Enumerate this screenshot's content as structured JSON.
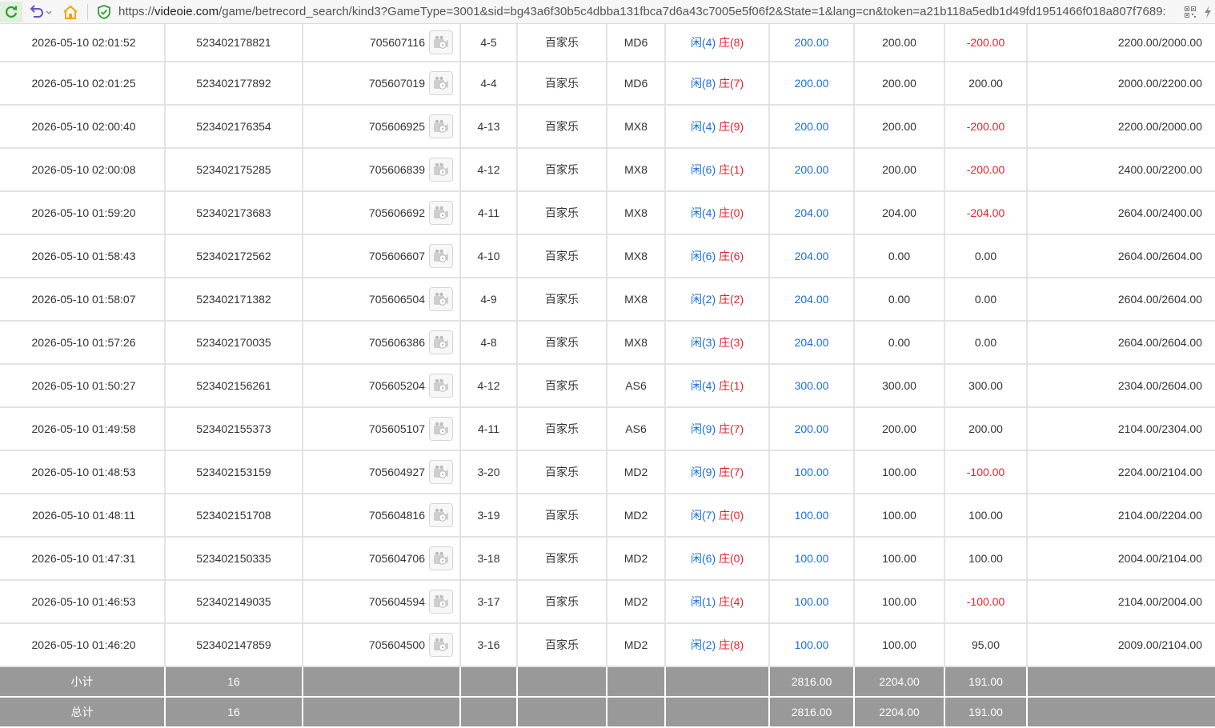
{
  "browser": {
    "url_scheme": "https://",
    "url_host": "videoie.com",
    "url_path": "/game/betrecord_search/kind3?GameType=3001&sid=bg43a6f30b5c4dbba131fbca7d6a43c7005e5f06f2&State=1&lang=cn&token=a21b118a5edb1d49fd1951466f018a807f7689:"
  },
  "colors": {
    "blue": "#1a6fe0",
    "red": "#e8202a",
    "summary_bg": "#999999"
  },
  "labels": {
    "player": "闲",
    "banker": "庄"
  },
  "rows": [
    {
      "time": "2026-05-10 02:01:52",
      "bet_no": "523402178821",
      "game_no": "705607116",
      "round": "4-5",
      "game": "百家乐",
      "table": "MD6",
      "player": "(4)",
      "banker": "(8)",
      "bet": "200.00",
      "valid": "200.00",
      "win": "-200.00",
      "win_color": "red",
      "balance": "2200.00/2000.00"
    },
    {
      "time": "2026-05-10 02:01:25",
      "bet_no": "523402177892",
      "game_no": "705607019",
      "round": "4-4",
      "game": "百家乐",
      "table": "MD6",
      "player": "(8)",
      "banker": "(7)",
      "bet": "200.00",
      "valid": "200.00",
      "win": "200.00",
      "win_color": "black",
      "balance": "2000.00/2200.00"
    },
    {
      "time": "2026-05-10 02:00:40",
      "bet_no": "523402176354",
      "game_no": "705606925",
      "round": "4-13",
      "game": "百家乐",
      "table": "MX8",
      "player": "(4)",
      "banker": "(9)",
      "bet": "200.00",
      "valid": "200.00",
      "win": "-200.00",
      "win_color": "red",
      "balance": "2200.00/2000.00"
    },
    {
      "time": "2026-05-10 02:00:08",
      "bet_no": "523402175285",
      "game_no": "705606839",
      "round": "4-12",
      "game": "百家乐",
      "table": "MX8",
      "player": "(6)",
      "banker": "(1)",
      "bet": "200.00",
      "valid": "200.00",
      "win": "-200.00",
      "win_color": "red",
      "balance": "2400.00/2200.00"
    },
    {
      "time": "2026-05-10 01:59:20",
      "bet_no": "523402173683",
      "game_no": "705606692",
      "round": "4-11",
      "game": "百家乐",
      "table": "MX8",
      "player": "(4)",
      "banker": "(0)",
      "bet": "204.00",
      "valid": "204.00",
      "win": "-204.00",
      "win_color": "red",
      "balance": "2604.00/2400.00"
    },
    {
      "time": "2026-05-10 01:58:43",
      "bet_no": "523402172562",
      "game_no": "705606607",
      "round": "4-10",
      "game": "百家乐",
      "table": "MX8",
      "player": "(6)",
      "banker": "(6)",
      "bet": "204.00",
      "valid": "0.00",
      "win": "0.00",
      "win_color": "black",
      "balance": "2604.00/2604.00"
    },
    {
      "time": "2026-05-10 01:58:07",
      "bet_no": "523402171382",
      "game_no": "705606504",
      "round": "4-9",
      "game": "百家乐",
      "table": "MX8",
      "player": "(2)",
      "banker": "(2)",
      "bet": "204.00",
      "valid": "0.00",
      "win": "0.00",
      "win_color": "black",
      "balance": "2604.00/2604.00"
    },
    {
      "time": "2026-05-10 01:57:26",
      "bet_no": "523402170035",
      "game_no": "705606386",
      "round": "4-8",
      "game": "百家乐",
      "table": "MX8",
      "player": "(3)",
      "banker": "(3)",
      "bet": "204.00",
      "valid": "0.00",
      "win": "0.00",
      "win_color": "black",
      "balance": "2604.00/2604.00"
    },
    {
      "time": "2026-05-10 01:50:27",
      "bet_no": "523402156261",
      "game_no": "705605204",
      "round": "4-12",
      "game": "百家乐",
      "table": "AS6",
      "player": "(4)",
      "banker": "(1)",
      "bet": "300.00",
      "valid": "300.00",
      "win": "300.00",
      "win_color": "black",
      "balance": "2304.00/2604.00"
    },
    {
      "time": "2026-05-10 01:49:58",
      "bet_no": "523402155373",
      "game_no": "705605107",
      "round": "4-11",
      "game": "百家乐",
      "table": "AS6",
      "player": "(9)",
      "banker": "(7)",
      "bet": "200.00",
      "valid": "200.00",
      "win": "200.00",
      "win_color": "black",
      "balance": "2104.00/2304.00"
    },
    {
      "time": "2026-05-10 01:48:53",
      "bet_no": "523402153159",
      "game_no": "705604927",
      "round": "3-20",
      "game": "百家乐",
      "table": "MD2",
      "player": "(9)",
      "banker": "(7)",
      "bet": "100.00",
      "valid": "100.00",
      "win": "-100.00",
      "win_color": "red",
      "balance": "2204.00/2104.00"
    },
    {
      "time": "2026-05-10 01:48:11",
      "bet_no": "523402151708",
      "game_no": "705604816",
      "round": "3-19",
      "game": "百家乐",
      "table": "MD2",
      "player": "(7)",
      "banker": "(0)",
      "bet": "100.00",
      "valid": "100.00",
      "win": "100.00",
      "win_color": "black",
      "balance": "2104.00/2204.00"
    },
    {
      "time": "2026-05-10 01:47:31",
      "bet_no": "523402150335",
      "game_no": "705604706",
      "round": "3-18",
      "game": "百家乐",
      "table": "MD2",
      "player": "(6)",
      "banker": "(0)",
      "bet": "100.00",
      "valid": "100.00",
      "win": "100.00",
      "win_color": "black",
      "balance": "2004.00/2104.00"
    },
    {
      "time": "2026-05-10 01:46:53",
      "bet_no": "523402149035",
      "game_no": "705604594",
      "round": "3-17",
      "game": "百家乐",
      "table": "MD2",
      "player": "(1)",
      "banker": "(4)",
      "bet": "100.00",
      "valid": "100.00",
      "win": "-100.00",
      "win_color": "red",
      "balance": "2104.00/2004.00"
    },
    {
      "time": "2026-05-10 01:46:20",
      "bet_no": "523402147859",
      "game_no": "705604500",
      "round": "3-16",
      "game": "百家乐",
      "table": "MD2",
      "player": "(2)",
      "banker": "(8)",
      "bet": "100.00",
      "valid": "100.00",
      "win": "95.00",
      "win_color": "black",
      "balance": "2009.00/2104.00"
    }
  ],
  "subtotal": {
    "label": "小计",
    "count": "16",
    "bet": "2816.00",
    "valid": "2204.00",
    "win": "191.00"
  },
  "total": {
    "label": "总计",
    "count": "16",
    "bet": "2816.00",
    "valid": "2204.00",
    "win": "191.00"
  }
}
